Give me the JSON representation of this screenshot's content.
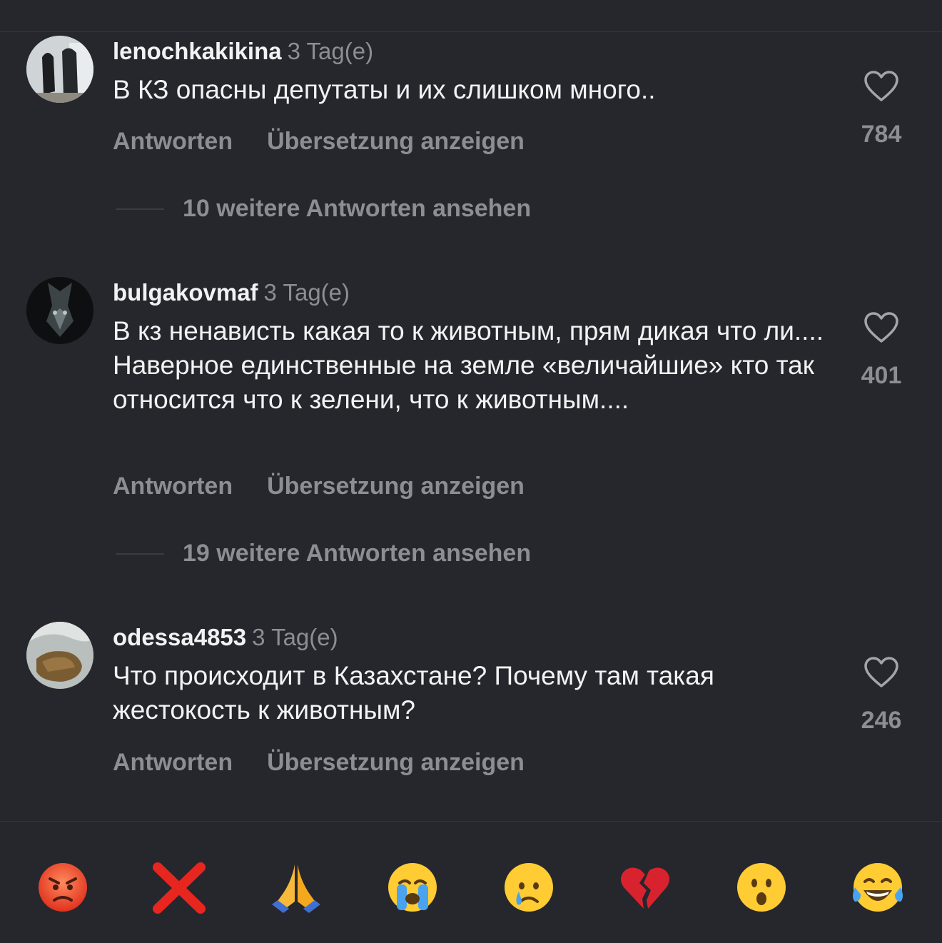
{
  "comments": [
    {
      "username": "lenochkakikina",
      "time": "3 Tag(e)",
      "text": "В КЗ опасны депутаты и их слишком много..",
      "reply_label": "Antworten",
      "translate_label": "Übersetzung anzeigen",
      "likes": "784",
      "more_replies": "10 weitere Antworten ansehen"
    },
    {
      "username": "bulgakovmaf",
      "time": "3 Tag(e)",
      "text": "В кз ненависть какая то к животным, прям дикая что ли.... Наверное единственные на земле «величайшие» кто так относится что к зелени, что к животным....",
      "reply_label": "Antworten",
      "translate_label": "Übersetzung anzeigen",
      "likes": "401",
      "more_replies": "19 weitere Antworten ansehen"
    },
    {
      "username": "odessa4853",
      "time": "3 Tag(e)",
      "text": "Что происходит в Казахстане? Почему там такая жестокость к животным?",
      "reply_label": "Antworten",
      "translate_label": "Übersetzung anzeigen",
      "likes": "246"
    }
  ],
  "emoji_bar": [
    {
      "name": "angry-face-emoji",
      "char": "😡"
    },
    {
      "name": "cross-mark-emoji",
      "char": "❌"
    },
    {
      "name": "folded-hands-emoji",
      "char": "🙏"
    },
    {
      "name": "loudly-crying-face-emoji",
      "char": "😭"
    },
    {
      "name": "crying-face-emoji",
      "char": "😢"
    },
    {
      "name": "broken-heart-emoji",
      "char": "💔"
    },
    {
      "name": "hushed-face-emoji",
      "char": "😮"
    },
    {
      "name": "tears-of-joy-emoji",
      "char": "😂"
    }
  ],
  "colors": {
    "background": "#25272c",
    "text_primary": "#f2f2f4",
    "text_secondary": "#8c8e94"
  }
}
